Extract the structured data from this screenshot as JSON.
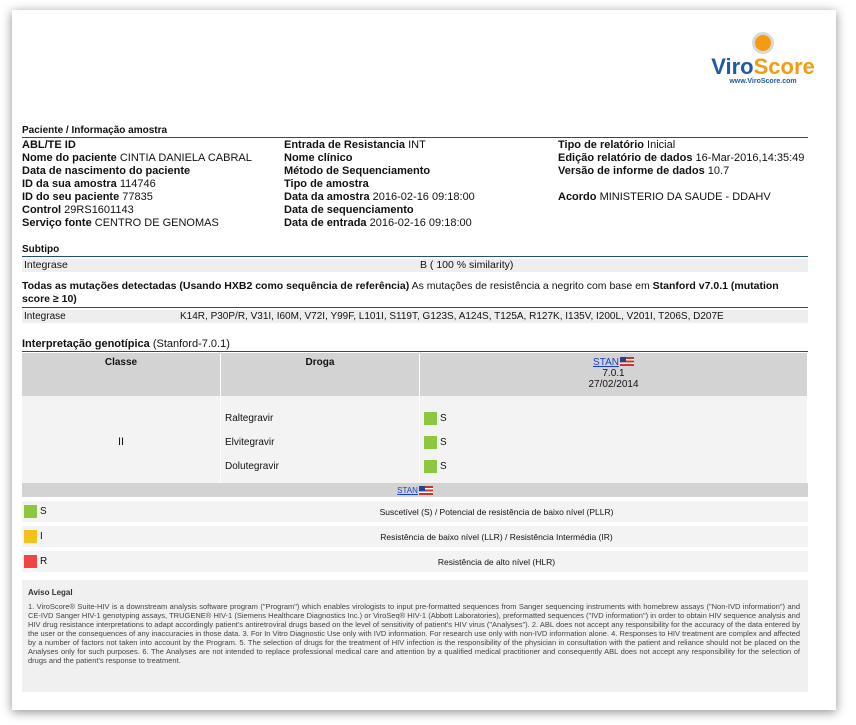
{
  "logo": {
    "brand_a": "Viro",
    "brand_b": "Score",
    "url": "www.ViroScore.com"
  },
  "patient_section": {
    "title": "Paciente / Informação amostra",
    "col1": [
      {
        "label": "ABL/TE ID",
        "value": ""
      },
      {
        "label": "Nome do paciente",
        "value": "CINTIA DANIELA CABRAL"
      },
      {
        "label": "Data de nascimento do paciente",
        "value": ""
      },
      {
        "label": "ID da sua amostra",
        "value": "114746"
      },
      {
        "label": "ID do seu paciente",
        "value": "77835"
      },
      {
        "label": "Control",
        "value": "29RS1601143"
      },
      {
        "label": "Serviço fonte",
        "value": "CENTRO DE GENOMAS"
      }
    ],
    "col2": [
      {
        "label": "Entrada de Resistancia",
        "value": "INT"
      },
      {
        "label": "Nome clínico",
        "value": ""
      },
      {
        "label": "Método de Sequenciamento",
        "value": ""
      },
      {
        "label": "Tipo de amostra",
        "value": ""
      },
      {
        "label": "Data da amostra",
        "value": "2016-02-16 09:18:00"
      },
      {
        "label": "Data de sequenciamento",
        "value": ""
      },
      {
        "label": "Data de entrada",
        "value": "2016-02-16 09:18:00"
      }
    ],
    "col3": [
      {
        "label": "Tipo de relatório",
        "value": "Inicial"
      },
      {
        "label": "Edição relatório de dados",
        "value": "16-Mar-2016,14:35:49"
      },
      {
        "label": "Versão de informe de dados",
        "value": "10.7"
      },
      {
        "label": "",
        "value": ""
      },
      {
        "label": "Acordo",
        "value": "MINISTERIO DA SAUDE - DDAHV"
      }
    ]
  },
  "subtype": {
    "title": "Subtipo",
    "gene": "Integrase",
    "value": "B ( 100 % similarity)"
  },
  "mutations": {
    "head_bold": "Todas as mutações detectadas (Usando HXB2 como sequência de referência)",
    "head_normal": "As mutações de resistência a negrito com base em",
    "head_bold2": "Stanford v7.0.1 (mutation score ≥ 10)",
    "gene": "Integrase",
    "list": "K14R, P30P/R, V31I, I60M, V72I, Y99F, L101I, S119T, G123S, A124S, T125A, R127K, I135V, I200L, V201I, T206S, D207E"
  },
  "genotypic": {
    "title": "Interpretação genotípica",
    "subtitle": "(Stanford-7.0.1)",
    "col_class": "Classe",
    "col_drug": "Droga",
    "stan_link": "STAN",
    "stan_version": "7.0.1",
    "stan_date": "27/02/2014",
    "class": "II",
    "rows": [
      {
        "drug": "Raltegravir",
        "result": "S",
        "color": "#8dc63f"
      },
      {
        "drug": "Elvitegravir",
        "result": "S",
        "color": "#8dc63f"
      },
      {
        "drug": "Dolutegravir",
        "result": "S",
        "color": "#8dc63f"
      }
    ]
  },
  "legend": {
    "stan_link": "STAN",
    "rows": [
      {
        "code": "S",
        "color": "#8dc63f",
        "desc": "Suscetível (S) / Potencial de resistência de baixo nível (PLLR)"
      },
      {
        "code": "I",
        "color": "#f5c21b",
        "desc": "Resistência de baixo nível (LLR) / Resistência Intermédia (IR)"
      },
      {
        "code": "R",
        "color": "#ef4444",
        "desc": "Resistência de alto nível (HLR)"
      }
    ]
  },
  "legal": {
    "title": "Aviso Legal",
    "body": "1. ViroScore® Suite-HIV is a downstream analysis software program (\"Program\") which enables virologists to input pre-formatted sequences from Sanger sequencing instruments with homebrew assays (\"Non-IVD information\") and CE-IVD Sanger HIV-1 genotyping assays, TRUGENE® HIV-1 (Siemens Healthcare Diagnostics Inc.) or ViroSeq® HIV-1 (Abbott Laboratories), preformatted sequences (\"IVD information\") in order to obtain HIV sequence analysis and HIV drug resistance interpretations to adapt accordingly patient's antiretroviral drugs based on the level of sensitivity of patient's HIV virus (\"Analyses\"). 2. ABL does not accept any responsibility for the accuracy of the data entered by the user or the consequences of any inaccuracies in those data. 3. For In Vitro Diagnostic Use only with IVD information. For research use only with non-IVD information alone. 4. Responses to HIV treatment are complex and affected by a number of factors not taken into account by the Program. 5. The selection of drugs for the treatment of HIV infection is the responsibility of the physician in consultation with the patient and reliance should not be placed on the Analyses only for such purposes. 6. The Analyses are not intended to replace professional medical care and attention by a qualified medical practitioner and consequently ABL does not accept any responsibility for the selection of drugs and the patient's response to treatment."
  }
}
